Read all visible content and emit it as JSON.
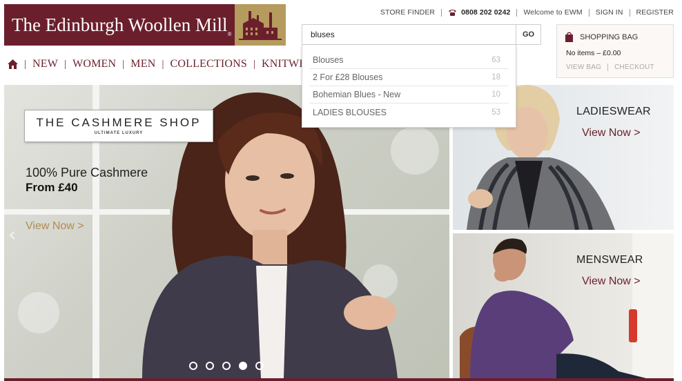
{
  "brand": {
    "name": "The Edinburgh Woollen Mill",
    "trademark": "®",
    "color": "#6b1f2c",
    "accent": "#b59b5e"
  },
  "utility": {
    "store_finder": "STORE FINDER",
    "phone_icon": "phone-icon",
    "phone": "0808 202 0242",
    "welcome": "Welcome to EWM",
    "sign_in": "SIGN IN",
    "register": "REGISTER"
  },
  "nav": {
    "home_icon": "home-icon",
    "items": [
      "NEW",
      "WOMEN",
      "MEN",
      "COLLECTIONS",
      "KNITWE"
    ]
  },
  "search": {
    "value": "bluses",
    "go_label": "GO",
    "suggestions": [
      {
        "label": "Blouses",
        "count": "63"
      },
      {
        "label": "2 For £28 Blouses",
        "count": "18"
      },
      {
        "label": "Bohemian Blues - New",
        "count": "10"
      },
      {
        "label": "LADIES BLOUSES",
        "count": "53"
      }
    ]
  },
  "bag": {
    "icon": "shopping-bag-icon",
    "title": "SHOPPING BAG",
    "items": "No items – £0.00",
    "view_bag": "VIEW BAG",
    "checkout": "CHECKOUT"
  },
  "hero": {
    "panel_title": "THE CASHMERE SHOP",
    "panel_subtitle": "ULTIMATE LUXURY",
    "line1": "100% Pure Cashmere",
    "line2": "From £40",
    "cta": "View Now >",
    "prev_arrow": "‹",
    "slides_total": 5,
    "active_slide": 4
  },
  "tiles": [
    {
      "label": "LADIESWEAR",
      "cta": "View Now >"
    },
    {
      "label": "MENSWEAR",
      "cta": "View Now >"
    }
  ]
}
